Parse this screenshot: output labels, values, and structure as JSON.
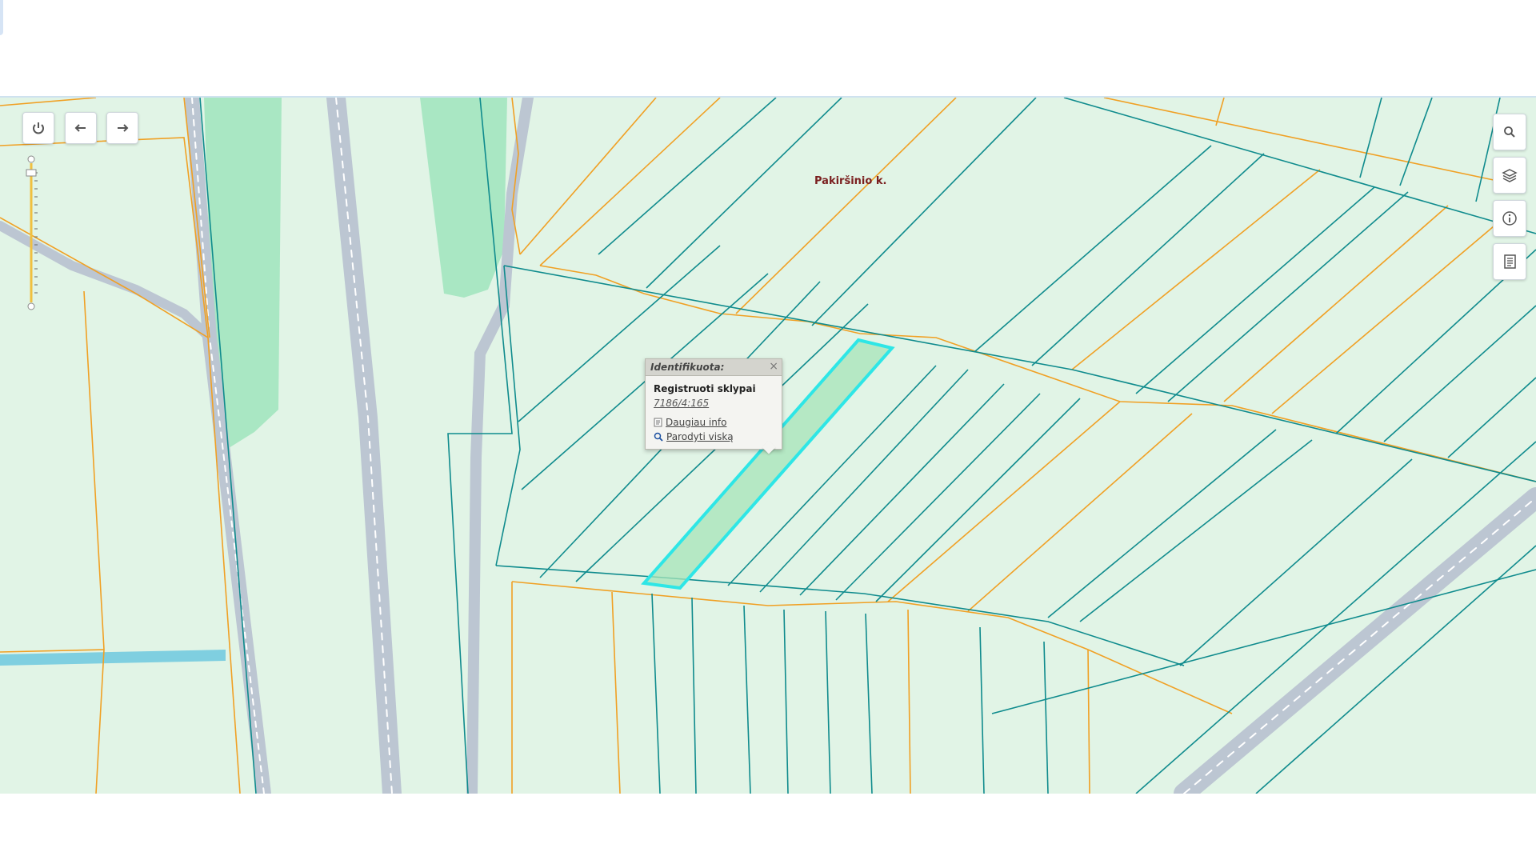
{
  "map": {
    "place_label": "Pakiršinio k."
  },
  "toolbar": {
    "buttons": [
      {
        "name": "power-icon"
      },
      {
        "name": "back-arrow-icon"
      },
      {
        "name": "forward-arrow-icon"
      }
    ]
  },
  "right_toolbar": {
    "buttons": [
      {
        "name": "search-icon"
      },
      {
        "name": "layers-icon"
      },
      {
        "name": "info-icon"
      },
      {
        "name": "list-icon"
      }
    ]
  },
  "popup": {
    "title": "Identifikuota:",
    "close": "×",
    "layer": "Registruoti sklypai",
    "parcel_id": "7186/4:165",
    "more_info": "Daugiau info",
    "show_all": "Parodyti viską"
  },
  "colors": {
    "map_background": "#e1f4e6",
    "parcel_line": "#0f8b8d",
    "boundary_line": "#f0a024",
    "road": "#cfd6de",
    "forest": "#a9e7c3",
    "water": "#7fcfe0",
    "selected_outline": "#2ee6e6",
    "label": "#7a1f1f"
  }
}
